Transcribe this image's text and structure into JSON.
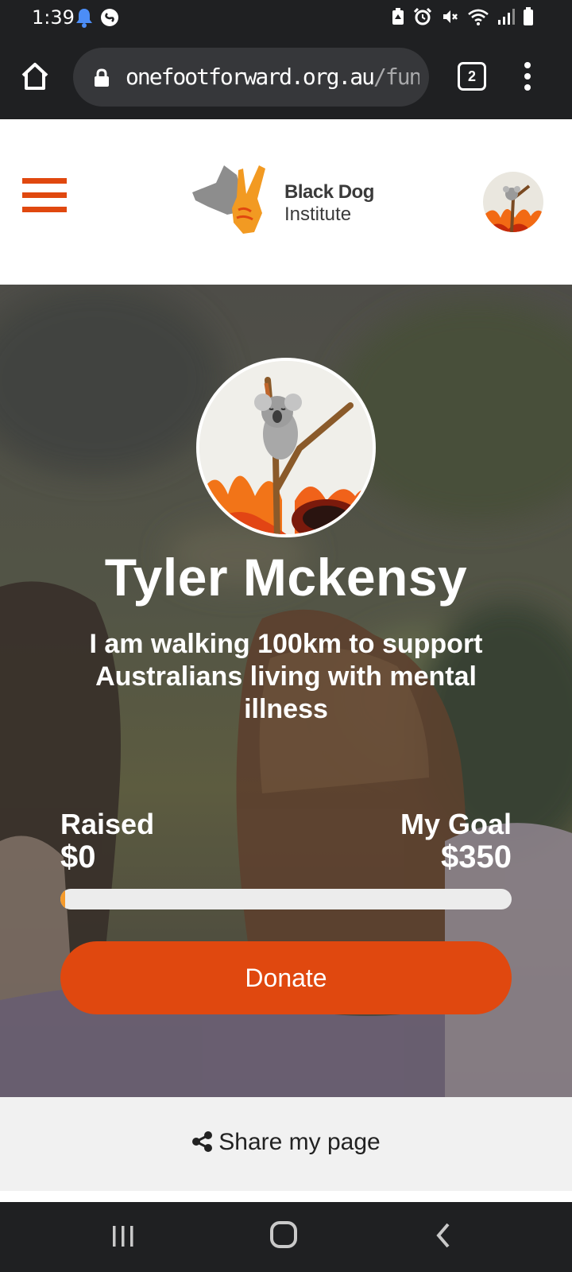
{
  "status_bar": {
    "time": "1:39",
    "left_icons": [
      "bell-icon",
      "shazam-icon"
    ],
    "right_icons": [
      "battery-saver-icon",
      "alarm-icon",
      "mute-icon",
      "wifi-icon",
      "signal-icon",
      "battery-icon"
    ]
  },
  "browser": {
    "url_domain": "onefootforward.org.au",
    "url_path": "/fund",
    "tab_count": "2"
  },
  "header": {
    "logo_line1": "Black Dog",
    "logo_line2": "Institute"
  },
  "profile": {
    "name": "Tyler Mckensy",
    "tagline": "I am walking 100km to support Australians living with mental illness",
    "raised_label": "Raised",
    "raised_value": "$0",
    "goal_label": "My Goal",
    "goal_value": "$350",
    "progress_fraction": 0,
    "donate_label": "Donate"
  },
  "share": {
    "label": "Share my page"
  },
  "colors": {
    "accent": "#e0480f",
    "progress": "#f59a2b",
    "chrome": "#1f2022"
  }
}
